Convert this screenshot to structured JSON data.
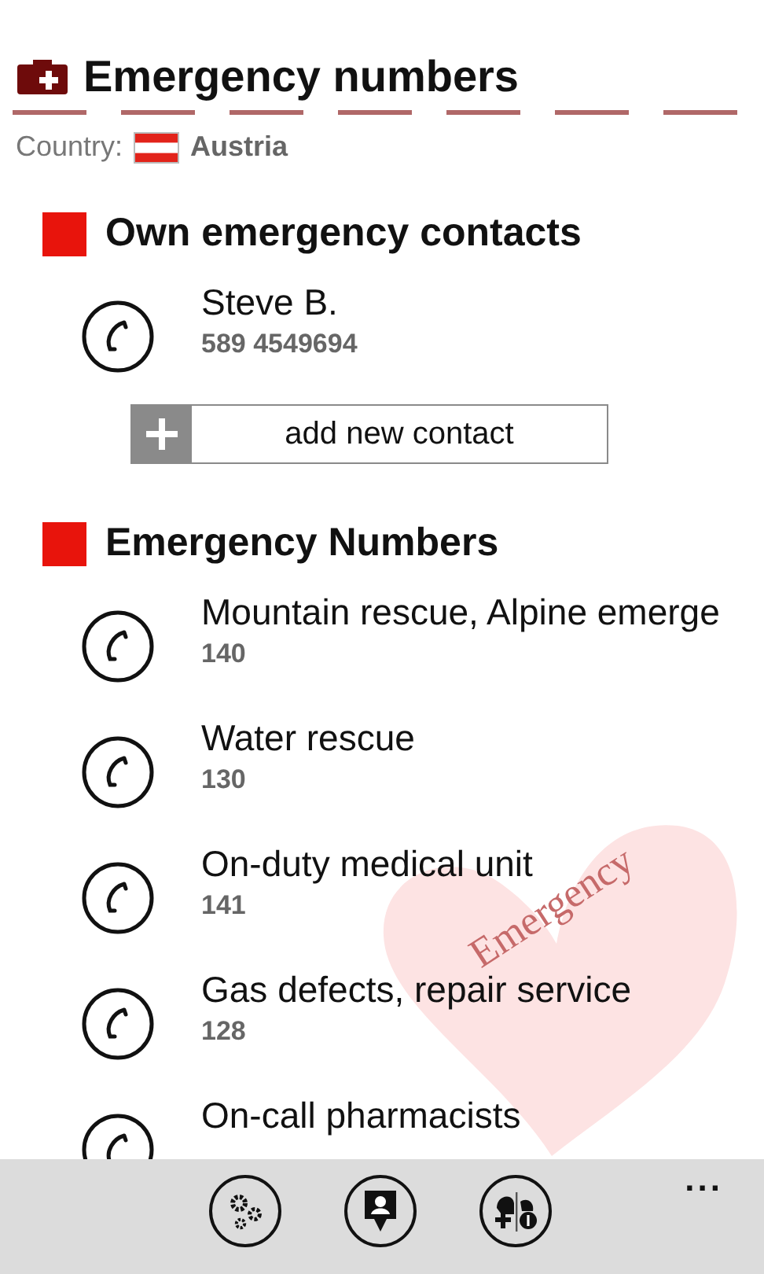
{
  "header": {
    "title": "Emergency numbers",
    "country_label": "Country:",
    "country": "Austria"
  },
  "sections": [
    {
      "title": "Own emergency contacts",
      "color": "#e8140c",
      "items": [
        {
          "name": "Steve B.",
          "number": "589 4549694"
        }
      ],
      "add_button": "add new contact"
    },
    {
      "title": "Emergency Numbers",
      "color": "#e8140c",
      "items": [
        {
          "name": "Mountain rescue, Alpine emerge",
          "number": "140"
        },
        {
          "name": "Water rescue",
          "number": "130"
        },
        {
          "name": "On-duty medical unit",
          "number": "141"
        },
        {
          "name": "Gas defects, repair service",
          "number": "128"
        },
        {
          "name": "On-call pharmacists"
        }
      ]
    }
  ],
  "watermark": {
    "text": "Emergency"
  },
  "app_bar": {
    "buttons": [
      {
        "kind": "settings"
      },
      {
        "kind": "contact"
      },
      {
        "kind": "services"
      }
    ],
    "more": "..."
  }
}
